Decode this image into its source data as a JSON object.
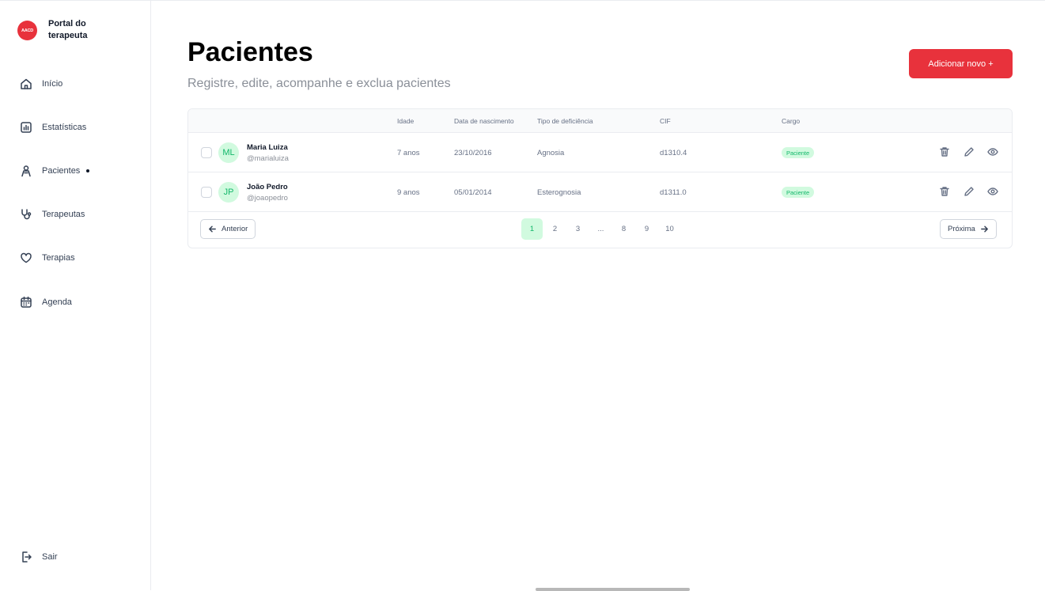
{
  "brand": {
    "logo_text": "AACD",
    "title": "Portal do terapeuta"
  },
  "sidebar": {
    "items": [
      {
        "label": "Início",
        "icon": "home-icon"
      },
      {
        "label": "Estatísticas",
        "icon": "chart-icon"
      },
      {
        "label": "Pacientes",
        "icon": "person-icon",
        "active": true
      },
      {
        "label": "Terapeutas",
        "icon": "stethoscope-icon"
      },
      {
        "label": "Terapias",
        "icon": "heart-icon"
      },
      {
        "label": "Agenda",
        "icon": "calendar-icon"
      }
    ],
    "logout": {
      "label": "Sair",
      "icon": "logout-icon"
    }
  },
  "header": {
    "title": "Pacientes",
    "subtitle": "Registre, edite, acompanhe e exclua pacientes",
    "add_button": "Adicionar novo +"
  },
  "table": {
    "columns": [
      "Idade",
      "Data de nascimento",
      "Tipo de deficiência",
      "CIF",
      "Cargo"
    ],
    "rows": [
      {
        "initials": "ML",
        "name": "Maria Luiza",
        "handle": "@marialuiza",
        "age": "7 anos",
        "birth": "23/10/2016",
        "type": "Agnosia",
        "cif": "d1310.4",
        "role": "Paciente"
      },
      {
        "initials": "JP",
        "name": "João Pedro",
        "handle": "@joaopedro",
        "age": "9 anos",
        "birth": "05/01/2014",
        "type": "Esterognosia",
        "cif": "d1311.0",
        "role": "Paciente"
      }
    ]
  },
  "pagination": {
    "prev": "Anterior",
    "next": "Próxima",
    "pages": [
      "1",
      "2",
      "3",
      "...",
      "8",
      "9",
      "10"
    ],
    "current": "1"
  },
  "colors": {
    "accent": "#e8323c",
    "success_bg": "#d1fadf",
    "success": "#12b76a"
  }
}
